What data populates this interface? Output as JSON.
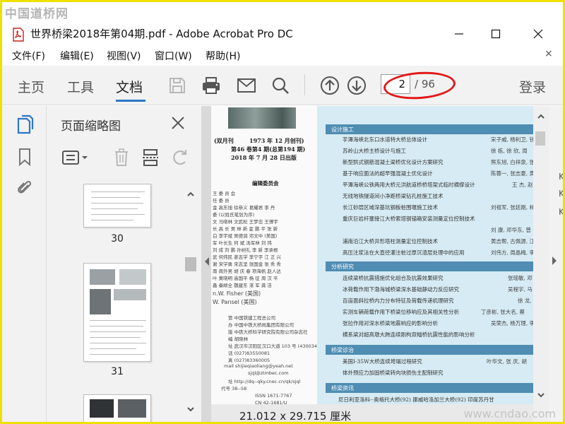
{
  "watermarks": {
    "top": "中国道桥网",
    "bottom": "www.cndao.com"
  },
  "window": {
    "title": "世界桥梁2018年第04期.pdf - Adobe Acrobat Pro DC",
    "min_glyph": "—",
    "max_glyph": "☐",
    "close_glyph": "✕"
  },
  "menu": {
    "items": [
      "文件(F)",
      "编辑(E)",
      "视图(V)",
      "窗口(W)",
      "帮助(H)"
    ],
    "close": "×"
  },
  "toolbar": {
    "tabs": [
      "主页",
      "工具",
      "文档"
    ],
    "active_tab": "文档",
    "page_current": "2",
    "page_total": "/ 96",
    "login": "登录",
    "highlight_color": "#e21818"
  },
  "thumbnails_panel": {
    "title": "页面缩略图",
    "pages": [
      "30",
      "31"
    ]
  },
  "document": {
    "masthead": [
      "(双月刊",
      "1973 年 12 月创刊)",
      "第46 卷第4 期(总第194 期)",
      "2018 年 7 月 28 日出版"
    ],
    "editorial_title": "编辑委员会",
    "left_column": [
      "王 委 员 会 ",
      "任 委 员",
      "金 高东旭 徐恭义 葛耀君 李 丹",
      "委 (以姓氏笔划为序)",
      "文 马晓林 文武松 王梦忠 王博宇",
      "长 高 长 吴 林 新 金 鹏 平 张 新",
      "白 李宇斌 吴德润 邓文中 (美国)",
      "军 叶长生 何 斌 汤军林 刘 玮",
      "刘 成 刘 鹏 孙树礼 李 新 李承根",
      "武 何伟民 姜志学 李宁宇 江 正 兴",
      "谢 宋学勇 宋志坚 张国金 张 秀 秀",
      "南 周外男 胡 庆 春 项海帆 赵人达",
      "叶 黄晓明 高国平 杨 征 周 汉 平",
      "鑫 秦顺全 魏建东 湛 军 龚 洁",
      "n.W. Fisher (美国)",
      "W. Pansel (美国)",
      "管 中国铁建工程总公司",
      "办 中国中铁大桥局集团有限公司",
      "版 中铁大桥科学研究院有限公司杂志社",
      "编 胡晓林",
      "址 武汉市汉阳区汉口大道 103 号 (430034)",
      "话 (027)83550081",
      "真 (027)83360005",
      "mail shijieqiaoliang@yeah.net",
      "sjql@ztmbec.com",
      "址 http://dq--qky.cnec.cn/qk/sjql",
      "代号 38--58",
      "ISSN 1671-7767",
      "CN 42-1681/U",
      "行数 中国铁路建设出版发行",
      "刷 武汉市印达数码印务有限公司"
    ],
    "sections": [
      {
        "title": "设计施工",
        "items": [
          {
            "text": "芋潭海峡北东口水道特大桥总体设计",
            "authors": "宋子威, 杨利卫, 钱"
          },
          {
            "text": "苏岭山大桥主桥设计与施工",
            "authors": "徐 栋, 徐 欣, 周"
          },
          {
            "text": "新型拱式钢筋混凝土梁桥优化设计方案研究",
            "authors": "熊东旭, 白祥泉, 张"
          },
          {
            "text": "基于响应面法的超早强混凝土优化设计",
            "authors": "陈蓉一, 张志豪, 黄"
          },
          {
            "text": "平潭海峡公铁两用大桥元洪航道桥桥塔架式临时横撑设计",
            "authors": "王 杰, 赵"
          },
          {
            "text": "无线地铁隧道间小净距桥梁钻孔桩施工技术",
            "authors": ""
          },
          {
            "text": "长江砂层区域深基坑钢板桩围堰施工技术",
            "authors": "刘祖军, 张廷刚, 林"
          },
          {
            "text": "重庆巨岩杆塞接江大桥索塔钢锚箱安装测量定位控制技术",
            "authors": ""
          },
          {
            "text": "",
            "authors": "刘 康, 邓华东, 曾"
          },
          {
            "text": "浦南沿江大桥井形塔柱测量定位控制技术",
            "authors": "黄志帮, 古佩源, 江"
          },
          {
            "text": "高压注浆法在大直径灌注桩过厚沉渣层处理中的应用",
            "authors": "刘伟方, 周晶梅, 李"
          }
        ]
      },
      {
        "title": "分析研究",
        "items": [
          {
            "text": "连续梁桥抗震措施优化组合及抗震效果研究",
            "authors": "张瑶敏, 邓"
          },
          {
            "text": "冰荷载作用下渤海城桥梁深水基础静动力反应研究",
            "authors": "吴程宇, 马"
          },
          {
            "text": "百亩面斜拉桥内力分布特征及荷载传递机理研究",
            "authors": "徐 龙, 郑"
          },
          {
            "text": "实测车辆荷载作用下桥梁位移响应及其相关性分析",
            "authors": "丁彦彬, 张大名, 蔡"
          },
          {
            "text": "张拉作用对深水桥梁地震响应的影响分析",
            "authors": "吴荣杰, 杨万理, 李"
          },
          {
            "text": "横系梁对超高墩大跨连续刚构双幅桥抗震性能的影响分析",
            "authors": ""
          }
        ]
      },
      {
        "title": "桥梁诊治",
        "items": [
          {
            "text": "美国I-35W大桥连续垮塌过程研究",
            "authors": "叶华文, 张 庆, 胡"
          },
          {
            "text": "体外预应力加固桥梁转向块损伤主配制研究",
            "authors": ""
          }
        ]
      },
      {
        "title": "桥梁资讯",
        "items": [
          {
            "text": "尼日利亚洛科--奥格托大桥(92)  挪威哈洛加兰大桥(92)  印度苏丹甘",
            "authors": ""
          }
        ]
      }
    ],
    "page_dimensions": "21.012 x 29.715 厘米"
  },
  "right_strip_glyphs": [
    "K",
    "K",
    "K"
  ]
}
